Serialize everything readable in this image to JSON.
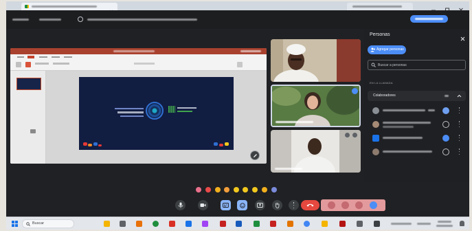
{
  "browser": {
    "tab_icon": "meet-icon",
    "window_controls": [
      "minimize-icon",
      "maximize-icon",
      "close-icon"
    ]
  },
  "people_panel": {
    "title": "Personas",
    "add_people_label": "Agregar personas",
    "search_placeholder": "Buscar a personas",
    "section_label": "EN LA LLAMADA",
    "group_label": "Colaboradores",
    "icons": [
      "close-icon",
      "add-person-icon",
      "search-icon",
      "chevron-up-icon",
      "more-vert-icon"
    ]
  },
  "call_controls": {
    "buttons": [
      "mic-icon",
      "camera-icon",
      "captions-icon",
      "emoji-icon",
      "present-icon",
      "raise-hand-icon",
      "more-options-icon"
    ],
    "hang_up_icon": "hang-up-icon",
    "side_icons": [
      "info-icon",
      "people-icon",
      "chat-icon",
      "activities-icon"
    ]
  },
  "reactions": {
    "icon": "reaction-emoji-icon",
    "colors": [
      "#e8708c",
      "#e94a4a",
      "#f2b01e",
      "#f29e3c",
      "#f2c81e",
      "#f2c81e",
      "#f2c81e",
      "#f2b01e",
      "#7a8bdb"
    ]
  },
  "taskbar": {
    "search_label": "Buscar",
    "icons": [
      "windows-start-icon",
      "search-icon"
    ]
  },
  "colors": {
    "accent_blue": "#4c8df6",
    "hang_up_red": "#e5483f",
    "stage_background": "#202124",
    "powerpoint_title_bar": "#a9412f",
    "slide_background": "#121d42"
  }
}
